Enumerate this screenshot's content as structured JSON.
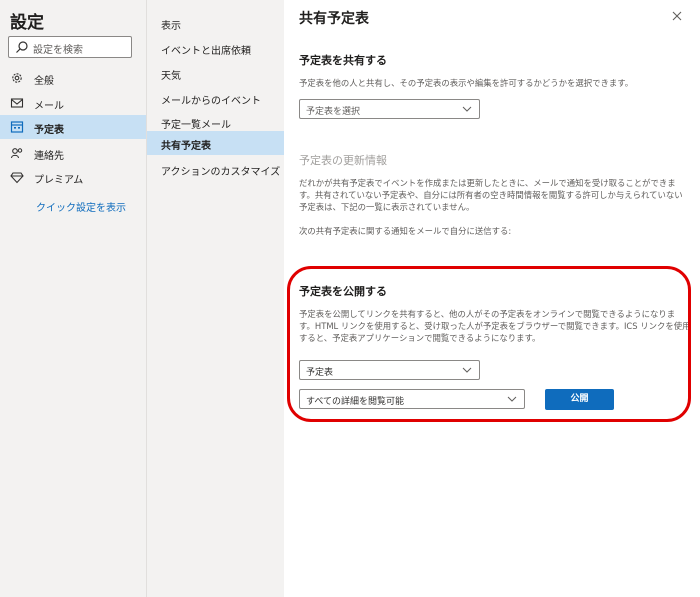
{
  "sidebar": {
    "title": "設定",
    "search_placeholder": "設定を検索",
    "items": [
      {
        "label": "全般",
        "icon": "gear-icon"
      },
      {
        "label": "メール",
        "icon": "mail-icon"
      },
      {
        "label": "予定表",
        "icon": "calendar-icon",
        "active": true
      },
      {
        "label": "連絡先",
        "icon": "people-icon"
      },
      {
        "label": "プレミアム",
        "icon": "diamond-icon"
      }
    ],
    "quick_settings_link": "クイック設定を表示"
  },
  "subnav": {
    "items": [
      {
        "label": "表示"
      },
      {
        "label": "イベントと出席依頼"
      },
      {
        "label": "天気"
      },
      {
        "label": "メールからのイベント"
      },
      {
        "label": "予定一覧メール"
      },
      {
        "label": "共有予定表",
        "active": true
      },
      {
        "label": "アクションのカスタマイズ"
      }
    ]
  },
  "main": {
    "title": "共有予定表",
    "share_section": {
      "heading": "予定表を共有する",
      "description": "予定表を他の人と共有し、その予定表の表示や編集を許可するかどうかを選択できます。",
      "calendar_select_placeholder": "予定表を選択"
    },
    "updates_section": {
      "heading": "予定表の更新情報",
      "description": "だれかが共有予定表でイベントを作成または更新したときに、メールで通知を受け取ることができます。共有されていない予定表や、自分には所有者の空き時間情報を閲覧する許可しか与えられていない予定表は、下記の一覧に表示されていません。",
      "notify_label": "次の共有予定表に関する通知をメールで自分に送信する:"
    },
    "publish_section": {
      "heading": "予定表を公開する",
      "description": "予定表を公開してリンクを共有すると、他の人がその予定表をオンラインで閲覧できるようになります。HTML リンクを使用すると、受け取った人が予定表をブラウザーで閲覧できます。ICS リンクを使用すると、予定表アプリケーションで閲覧できるようになります。",
      "calendar_select_value": "予定表",
      "permission_select_value": "すべての詳細を閲覧可能",
      "publish_button": "公開"
    }
  },
  "colors": {
    "accent": "#0f6cbd",
    "selected_bg": "#c7e0f4",
    "nav_bg": "#f3f2f1",
    "annotation_red": "#e00000"
  }
}
